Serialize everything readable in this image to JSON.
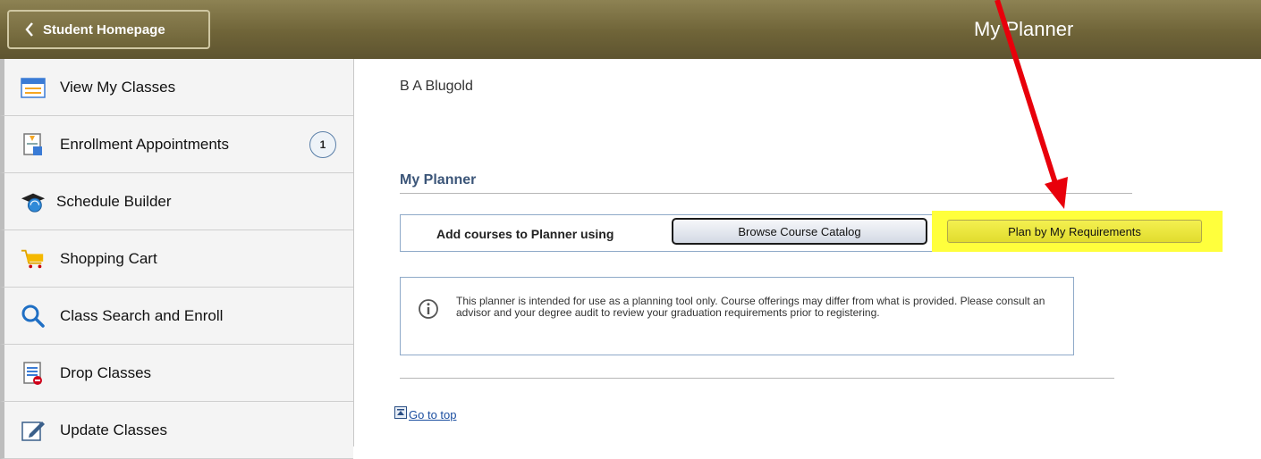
{
  "header": {
    "back_label": "Student Homepage",
    "title": "My Planner",
    "background_color": "#6f6438"
  },
  "sidebar": {
    "items": [
      {
        "label": "View My Classes",
        "icon": "calendar-icon"
      },
      {
        "label": "Enrollment Appointments",
        "icon": "appointment-icon",
        "badge": "1"
      },
      {
        "label": "Schedule Builder",
        "icon": "graduation-cap-icon"
      },
      {
        "label": "Shopping Cart",
        "icon": "shopping-cart-icon"
      },
      {
        "label": "Class Search and Enroll",
        "icon": "search-icon"
      },
      {
        "label": "Drop Classes",
        "icon": "drop-list-icon"
      },
      {
        "label": "Update Classes",
        "icon": "edit-icon"
      }
    ]
  },
  "main": {
    "student_name": "B A Blugold",
    "section_title": "My Planner",
    "add_courses_label": "Add courses to Planner using",
    "browse_button": "Browse Course Catalog",
    "plan_button": "Plan by My Requirements",
    "info_text": "This planner is intended for use as a planning tool only.  Course offerings may differ from what is provided.  Please consult an advisor and your degree audit to review your graduation requirements prior to registering.",
    "go_to_top": "Go to top"
  },
  "colors": {
    "accent_title": "#3b5578",
    "highlight": "#ffff3c",
    "annotation_arrow": "#e8000b",
    "link": "#1b4ea0"
  }
}
